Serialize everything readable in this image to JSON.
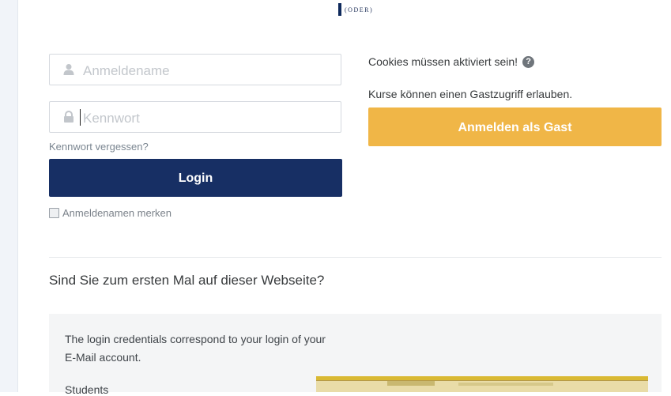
{
  "logo": {
    "text": "(ODER)"
  },
  "login": {
    "username_placeholder": "Anmeldename",
    "password_placeholder": "Kennwort",
    "forgot_link": "Kennwort vergessen?",
    "login_button": "Login",
    "remember_label": "Anmeldenamen merken"
  },
  "guest": {
    "cookies_note": "Cookies müssen aktiviert sein!",
    "guest_note": "Kurse können einen Gastzugriff erlauben.",
    "guest_button": "Anmelden als Gast"
  },
  "first_time": {
    "heading": "Sind Sie zum ersten Mal auf dieser Webseite?",
    "info_text": "The login credentials correspond to your login of your E-Mail account.",
    "students_label": "Students"
  },
  "icons": {
    "username": "user-icon",
    "password": "lock-icon",
    "help": "question-circle-icon"
  },
  "colors": {
    "login_button": "#172f64",
    "guest_button": "#f0b647",
    "info_box": "#f4f5f6"
  }
}
